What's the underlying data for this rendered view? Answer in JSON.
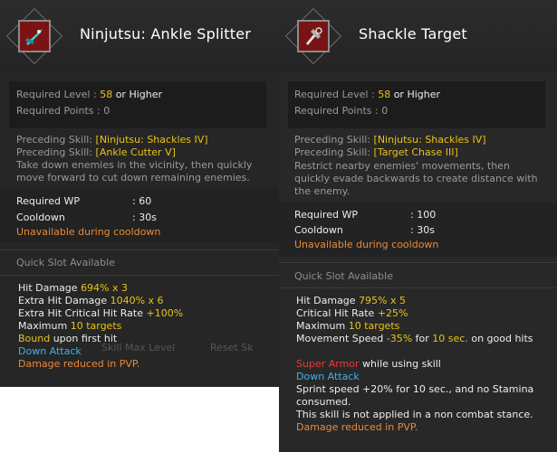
{
  "left": {
    "title": "Ninjutsu: Ankle Splitter",
    "icon": "skill-ankle-splitter-icon",
    "required_level_label": "Required Level : ",
    "required_level_value": "58",
    "required_level_suffix": " or Higher",
    "required_points_label": "Required Points : 0",
    "preceding1_label": "Preceding Skill: ",
    "preceding1_value": "[Ninjutsu: Shackles IV]",
    "preceding2_label": "Preceding Skill: ",
    "preceding2_value": "[Ankle Cutter V]",
    "description_1": "Take down enemies in the vicinity, then quickly",
    "description_2": "move forward to cut down remaining enemies.",
    "wp_label": "Required WP",
    "wp_value": ": 60",
    "cooldown_label": "Cooldown",
    "cooldown_value": ": 30s",
    "unavailable": "Unavailable during cooldown",
    "quick_slot": "Quick Slot Available",
    "effects": {
      "hit_damage_label": "Hit Damage ",
      "hit_damage_value": "694% x 3",
      "extra_hit_label": "Extra Hit Damage ",
      "extra_hit_value": "1040% x 6",
      "extra_crit_label": "Extra Hit Critical Hit Rate ",
      "extra_crit_value": "+100%",
      "maximum_label": "Maximum ",
      "maximum_value": "10 targets",
      "bound_word": "Bound",
      "bound_rest": " upon first hit",
      "down_attack": "Down Attack",
      "pvp": "Damage reduced in PVP."
    },
    "ghost_text_1": "Skill Max Level",
    "ghost_text_2": "Reset Sk"
  },
  "right": {
    "title": "Shackle Target",
    "icon": "skill-shackle-target-icon",
    "required_level_label": "Required Level : ",
    "required_level_value": "58",
    "required_level_suffix": " or Higher",
    "required_points_label": "Required Points : 0",
    "preceding1_label": "Preceding Skill: ",
    "preceding1_value": "[Ninjutsu: Shackles IV]",
    "preceding2_label": "Preceding Skill: ",
    "preceding2_value": "[Target Chase III]",
    "description_1": "Restrict nearby enemies' movements, then",
    "description_2": "quickly evade backwards to create distance with",
    "description_3": "the enemy.",
    "wp_label": "Required WP",
    "wp_value": ": 100",
    "cooldown_label": "Cooldown",
    "cooldown_value": ": 30s",
    "unavailable": "Unavailable during cooldown",
    "quick_slot": "Quick Slot Available",
    "effects": {
      "hit_damage_label": "Hit Damage ",
      "hit_damage_value": "795% x 5",
      "crit_label": "Critical Hit Rate ",
      "crit_value": "+25%",
      "maximum_label": "Maximum ",
      "maximum_value": "10 targets",
      "move_label": "Movement Speed ",
      "move_value": "-35%",
      "move_for": " for ",
      "move_duration": "10 sec.",
      "move_rest": " on good hits",
      "super_armor": "Super Armor",
      "super_armor_rest": " while using skill",
      "down_attack": "Down Attack",
      "sprint_1": "Sprint speed +20% for 10 sec., and no Stamina",
      "sprint_2": "consumed.",
      "non_combat": "This skill is not applied in a non combat stance.",
      "pvp": "Damage reduced in PVP."
    }
  },
  "colors": {
    "yellow": "#e8c21a",
    "orange": "#e88a3a",
    "blue": "#3fb2ee",
    "red": "#e83a3a"
  }
}
